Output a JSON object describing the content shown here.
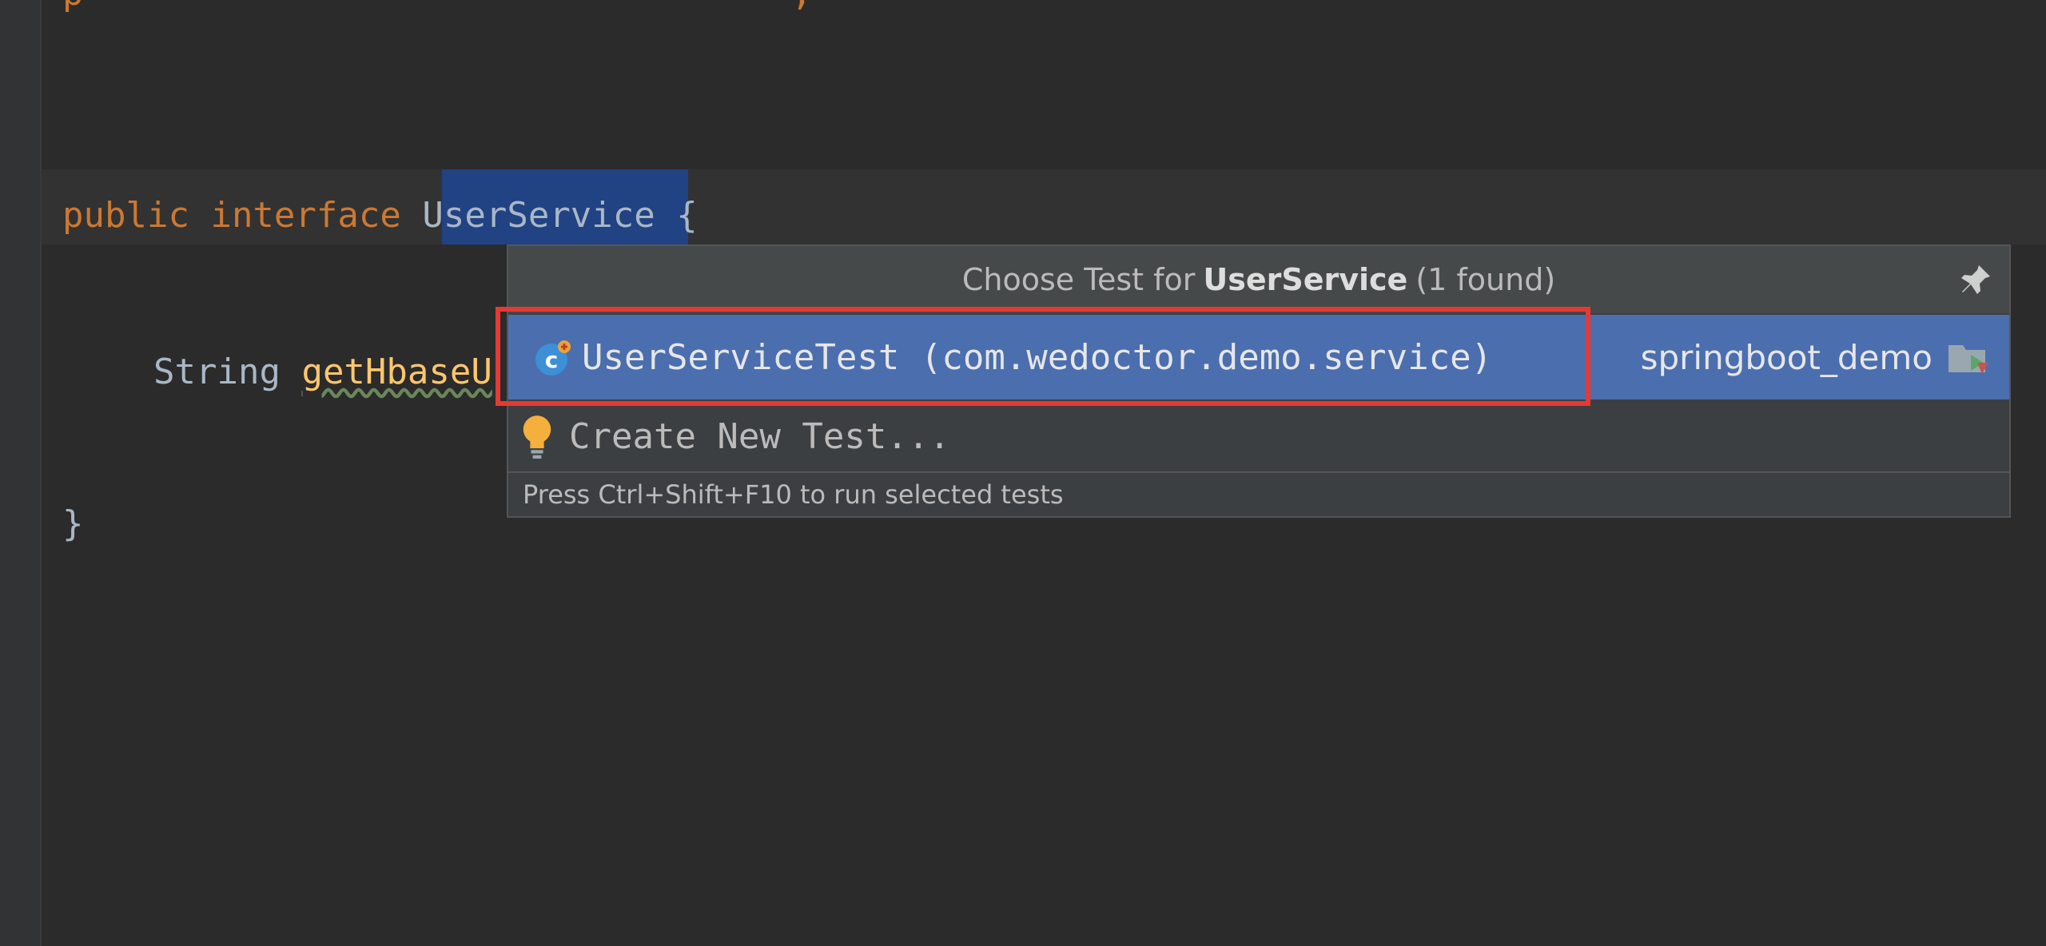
{
  "editor": {
    "top_fragment": "p",
    "top_fragment_end": ";",
    "decl": {
      "kw_public": "public",
      "kw_interface": "interface",
      "class_name": "UserService",
      "brace_open": "{"
    },
    "method": {
      "return_type": "String",
      "name_visible": "getHbaseU"
    },
    "brace_close": "}"
  },
  "popup": {
    "title_prefix": "Choose Test for",
    "title_class": "UserService",
    "title_count": "(1 found)",
    "pin_icon": "pin-icon",
    "items": [
      {
        "icon": "test-class-icon",
        "label": "UserServiceTest (com.wedoctor.demo.service)",
        "module": "springboot_demo",
        "module_icon": "test-folder-icon",
        "selected": true
      },
      {
        "icon": "lightbulb-icon",
        "label": "Create New Test...",
        "selected": false
      }
    ],
    "footer": "Press Ctrl+Shift+F10 to run selected tests"
  },
  "colors": {
    "background": "#2b2b2b",
    "keyword": "#cc7832",
    "selection": "#214283",
    "popup_selected": "#4b6eaf",
    "highlight_border": "#e53935"
  }
}
